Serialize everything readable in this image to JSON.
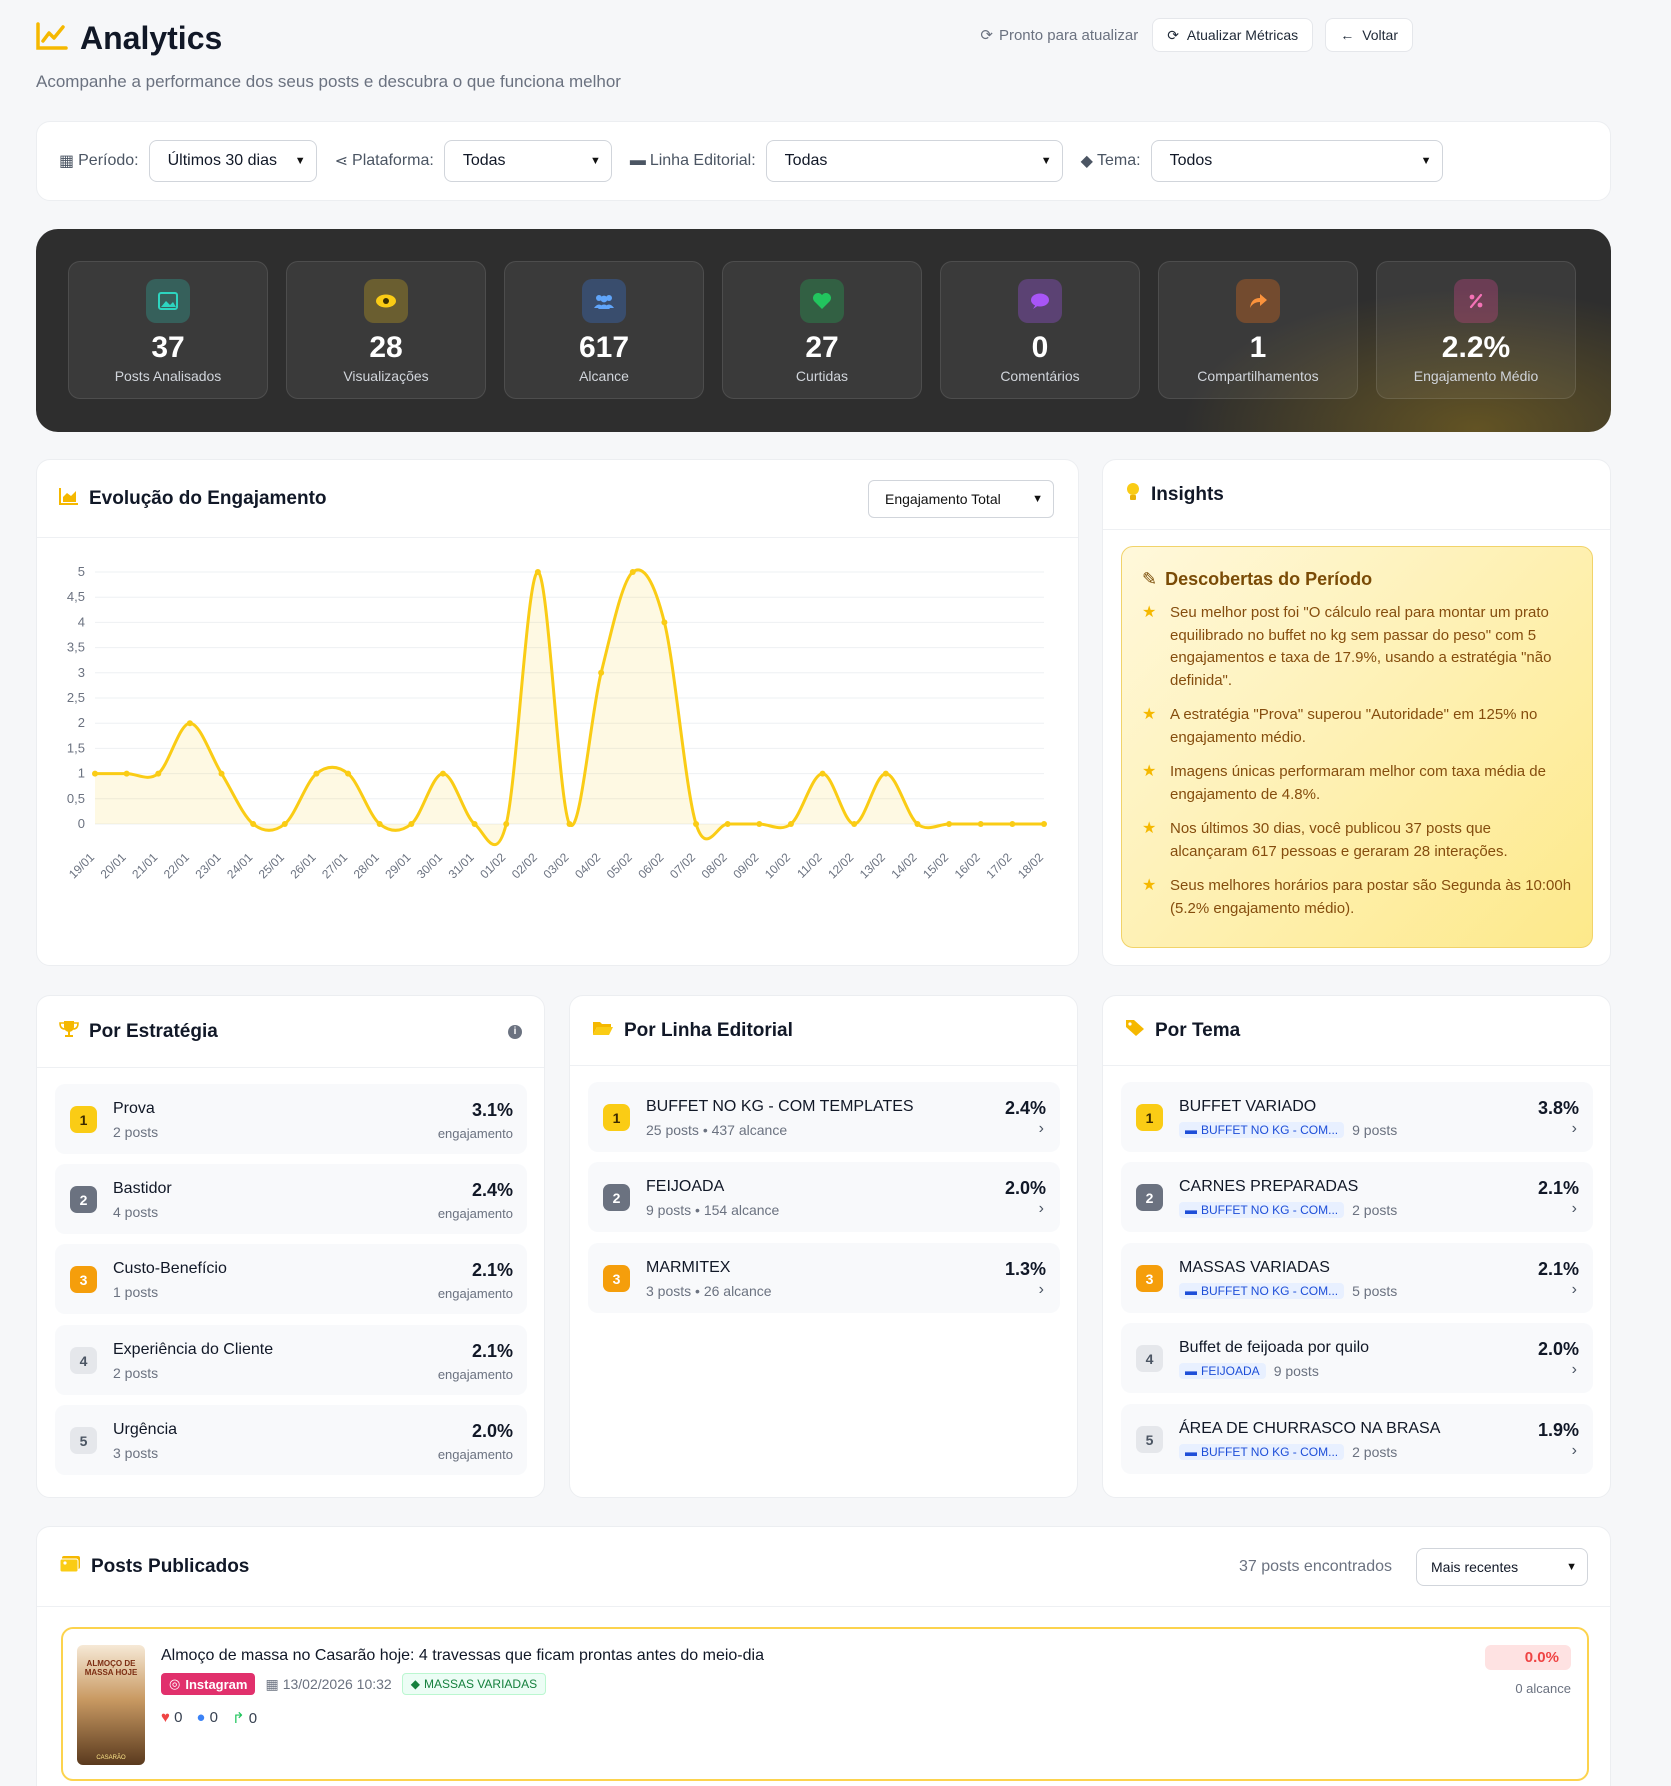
{
  "header": {
    "title": "Analytics",
    "subtitle": "Acompanhe a performance dos seus posts e descubra o que funciona melhor",
    "status": "Pronto para atualizar",
    "refresh_label": "Atualizar Métricas",
    "back_label": "Voltar"
  },
  "filters": [
    {
      "label": "Período:",
      "value": "Últimos 30 dias",
      "icon": "calendar-icon"
    },
    {
      "label": "Plataforma:",
      "value": "Todas",
      "icon": "share-icon"
    },
    {
      "label": "Linha Editorial:",
      "value": "Todas",
      "icon": "folder-icon"
    },
    {
      "label": "Tema:",
      "value": "Todos",
      "icon": "tag-icon"
    }
  ],
  "stats": [
    {
      "value": "37",
      "label": "Posts Analisados",
      "icon": "image-icon",
      "color": "#2dd4bf"
    },
    {
      "value": "28",
      "label": "Visualizações",
      "icon": "eye-icon",
      "color": "#facc15"
    },
    {
      "value": "617",
      "label": "Alcance",
      "icon": "users-icon",
      "color": "#3b82f6"
    },
    {
      "value": "27",
      "label": "Curtidas",
      "icon": "heart-icon",
      "color": "#22c55e"
    },
    {
      "value": "0",
      "label": "Comentários",
      "icon": "comment-icon",
      "color": "#a855f7"
    },
    {
      "value": "1",
      "label": "Compartilhamentos",
      "icon": "share-arrow-icon",
      "color": "#f97316"
    },
    {
      "value": "2.2%",
      "label": "Engajamento Médio",
      "icon": "percent-icon",
      "color": "#ec4899"
    }
  ],
  "chart_section": {
    "title": "Evolução do Engajamento",
    "metric_select": "Engajamento Total"
  },
  "chart_data": {
    "type": "area",
    "categories": [
      "19/01",
      "20/01",
      "21/01",
      "22/01",
      "23/01",
      "24/01",
      "25/01",
      "26/01",
      "27/01",
      "28/01",
      "29/01",
      "30/01",
      "31/01",
      "01/02",
      "02/02",
      "03/02",
      "04/02",
      "05/02",
      "06/02",
      "07/02",
      "08/02",
      "09/02",
      "10/02",
      "11/02",
      "12/02",
      "13/02",
      "14/02",
      "15/02",
      "16/02",
      "17/02",
      "18/02"
    ],
    "values": [
      1,
      1,
      1,
      2,
      1,
      0,
      0,
      1,
      1,
      0,
      0,
      1,
      0,
      0,
      5,
      0,
      3,
      5,
      4,
      0,
      0,
      0,
      0,
      1,
      0,
      1,
      0,
      0,
      0,
      0,
      0
    ],
    "yticks": [
      "0",
      "0,5",
      "1",
      "1,5",
      "2",
      "2,5",
      "3",
      "3,5",
      "4",
      "4,5",
      "5"
    ],
    "ylim": [
      0,
      5
    ],
    "grid": true,
    "color": "#facc15"
  },
  "insights": {
    "title": "Insights",
    "box_title": "Descobertas do Período",
    "items": [
      "Seu melhor post foi \"O cálculo real para montar um prato equilibrado no buffet no kg sem passar do peso\" com 5 engajamentos e taxa de 17.9%, usando a estratégia \"não definida\".",
      "A estratégia \"Prova\" superou \"Autoridade\" em 125% no engajamento médio.",
      "Imagens únicas performaram melhor com taxa média de engajamento de 4.8%.",
      "Nos últimos 30 dias, você publicou 37 posts que alcançaram 617 pessoas e geraram 28 interações.",
      "Seus melhores horários para postar são Segunda às 10:00h (5.2% engajamento médio)."
    ]
  },
  "por_estrategia": {
    "title": "Por Estratégia",
    "items": [
      {
        "rank": "1",
        "name": "Prova",
        "sub": "2 posts",
        "value": "3.1%",
        "unit": "engajamento"
      },
      {
        "rank": "2",
        "name": "Bastidor",
        "sub": "4 posts",
        "value": "2.4%",
        "unit": "engajamento"
      },
      {
        "rank": "3",
        "name": "Custo-Benefício",
        "sub": "1 posts",
        "value": "2.1%",
        "unit": "engajamento"
      },
      {
        "rank": "4",
        "name": "Experiência do Cliente",
        "sub": "2 posts",
        "value": "2.1%",
        "unit": "engajamento"
      },
      {
        "rank": "5",
        "name": "Urgência",
        "sub": "3 posts",
        "value": "2.0%",
        "unit": "engajamento"
      }
    ]
  },
  "por_linha": {
    "title": "Por Linha Editorial",
    "items": [
      {
        "rank": "1",
        "name": "BUFFET NO KG - COM TEMPLATES",
        "sub": "25 posts • 437 alcance",
        "value": "2.4%"
      },
      {
        "rank": "2",
        "name": "FEIJOADA",
        "sub": "9 posts • 154 alcance",
        "value": "2.0%"
      },
      {
        "rank": "3",
        "name": "MARMITEX",
        "sub": "3 posts • 26 alcance",
        "value": "1.3%"
      }
    ]
  },
  "por_tema": {
    "title": "Por Tema",
    "items": [
      {
        "rank": "1",
        "name": "BUFFET VARIADO",
        "tag": "BUFFET NO KG - COM...",
        "sub": "9 posts",
        "value": "3.8%"
      },
      {
        "rank": "2",
        "name": "CARNES PREPARADAS",
        "tag": "BUFFET NO KG - COM...",
        "sub": "2 posts",
        "value": "2.1%"
      },
      {
        "rank": "3",
        "name": "MASSAS VARIADAS",
        "tag": "BUFFET NO KG - COM...",
        "sub": "5 posts",
        "value": "2.1%"
      },
      {
        "rank": "4",
        "name": "Buffet de feijoada por quilo",
        "tag": "FEIJOADA",
        "sub": "9 posts",
        "value": "2.0%"
      },
      {
        "rank": "5",
        "name": "ÁREA DE CHURRASCO NA BRASA",
        "tag": "BUFFET NO KG - COM...",
        "sub": "2 posts",
        "value": "1.9%"
      }
    ]
  },
  "posts": {
    "title": "Posts Publicados",
    "count": "37 posts encontrados",
    "sort": "Mais recentes",
    "items": [
      {
        "title": "Almoço de massa no Casarão hoje: 4 travessas que ficam prontas antes do meio-dia",
        "thumb_text": "ALMOÇO DE MASSA HOJE",
        "thumb_brand": "CASARÃO",
        "platform": "Instagram",
        "date": "13/02/2026 10:32",
        "theme": "MASSAS VARIADAS",
        "likes": "0",
        "comments": "0",
        "shares": "0",
        "engagement": "0.0%",
        "reach": "0 alcance"
      }
    ]
  }
}
